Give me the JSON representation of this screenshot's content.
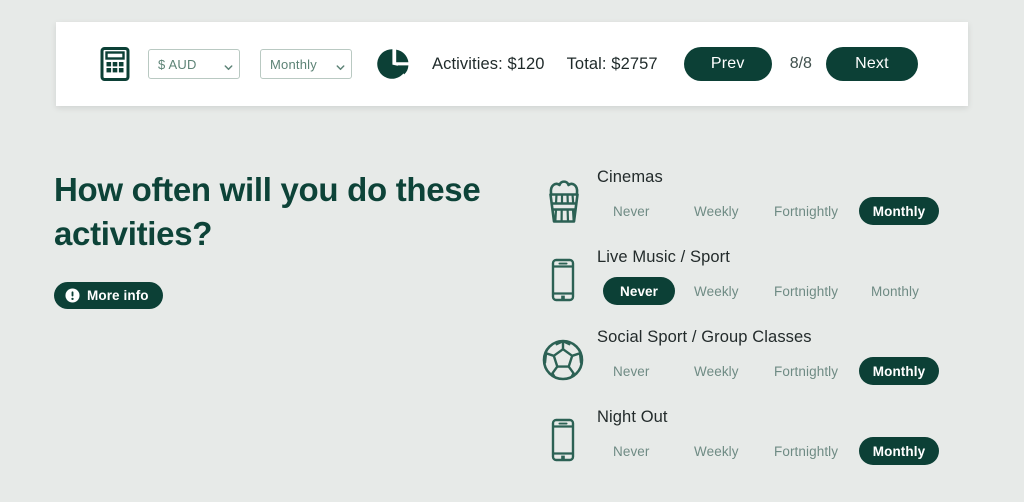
{
  "toolbar": {
    "calculator_icon": "calculator-icon",
    "currency_select": {
      "value": "$ AUD",
      "caret_icon": "chevron-down-icon"
    },
    "period_select": {
      "value": "Monthly",
      "caret_icon": "chevron-down-icon"
    },
    "pie_icon": "pie-chart-icon",
    "activities_stat": "Activities: $120",
    "total_stat": "Total: $2757",
    "prev_label": "Prev",
    "page_indicator": "8/8",
    "next_label": "Next"
  },
  "left": {
    "heading": "How often will you do these activities?",
    "more_info_label": "More info",
    "more_info_icon": "info-exclamation-icon"
  },
  "activities": [
    {
      "title": "Cinemas",
      "icon": "popcorn-icon",
      "options": [
        "Never",
        "Weekly",
        "Fortnightly",
        "Monthly"
      ],
      "selected": "Monthly"
    },
    {
      "title": "Live Music / Sport",
      "icon": "smartphone-icon",
      "options": [
        "Never",
        "Weekly",
        "Fortnightly",
        "Monthly"
      ],
      "selected": "Never"
    },
    {
      "title": "Social Sport / Group Classes",
      "icon": "soccer-ball-icon",
      "options": [
        "Never",
        "Weekly",
        "Fortnightly",
        "Monthly"
      ],
      "selected": "Monthly"
    },
    {
      "title": "Night Out",
      "icon": "smartphone-icon",
      "options": [
        "Never",
        "Weekly",
        "Fortnightly",
        "Monthly"
      ],
      "selected": "Monthly"
    }
  ],
  "colors": {
    "page_background": "#e7eae8",
    "card_background": "#ffffff",
    "brand_green": "#0c4036",
    "heading_green": "#0d4338",
    "muted_text": "#6f8b84",
    "select_border": "#b9c9c2"
  }
}
